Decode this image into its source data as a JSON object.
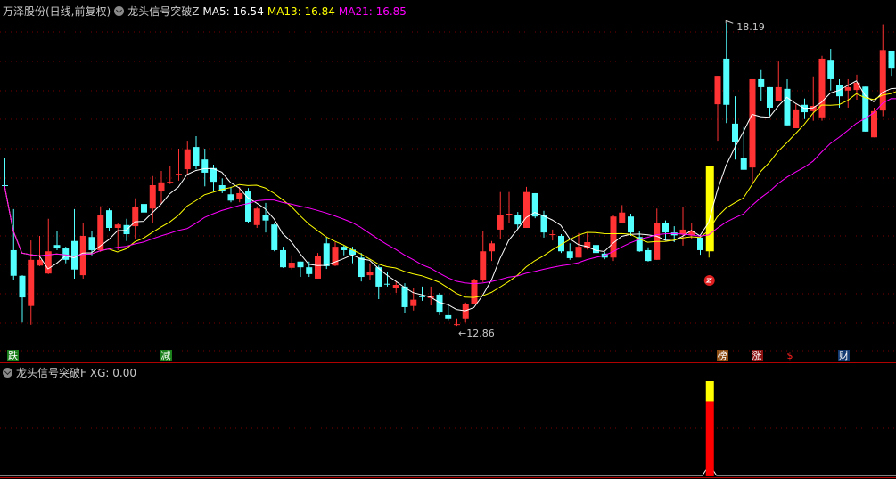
{
  "header": {
    "stock": "万泽股份(日线,前复权)",
    "indicator": "龙头信号突破Z",
    "ma5_label": "MA5: 16.54",
    "ma13_label": "MA13: 16.84",
    "ma21_label": "MA21: 16.85"
  },
  "sub_header": {
    "indicator": "龙头信号突破F",
    "xg_label": "XG: 0.00"
  },
  "markers": [
    {
      "text": "跌",
      "index": 0,
      "bg": "#1a7f1a",
      "fg": "#ffffff"
    },
    {
      "text": "减",
      "index": 18,
      "bg": "#1a7f1a",
      "fg": "#ffffff"
    },
    {
      "text": "榜",
      "index": 82,
      "bg": "#8b4a10",
      "fg": "#ffffff"
    },
    {
      "text": "涨",
      "index": 86,
      "bg": "#8b1010",
      "fg": "#ffffff"
    },
    {
      "text": "$",
      "index": 90,
      "bg": "transparent",
      "fg": "#ff2020"
    },
    {
      "text": "财",
      "index": 96,
      "bg": "#123a70",
      "fg": "#ffffff"
    }
  ],
  "colors": {
    "up": "#ff3333",
    "down": "#54ffff",
    "signal": "#ffff00",
    "ma5": "#ffffff",
    "ma13": "#ffff00",
    "ma21": "#ff00ff",
    "grid": "#7a0000"
  },
  "chart_data": {
    "type": "candlestick",
    "ylim": [
      12.88,
      18.19
    ],
    "high_label": "18.19",
    "low_label": "12.86",
    "high_index": 83,
    "low_index": 52,
    "signal_index": 81,
    "ohlc": [
      [
        15.35,
        15.82,
        15.29,
        15.34
      ],
      [
        14.21,
        14.93,
        13.68,
        13.76
      ],
      [
        13.76,
        13.77,
        12.94,
        13.38
      ],
      [
        13.23,
        14.38,
        12.9,
        14.04
      ],
      [
        13.94,
        14.46,
        13.93,
        14.04
      ],
      [
        13.8,
        14.76,
        13.79,
        14.19
      ],
      [
        14.3,
        14.54,
        14.21,
        14.24
      ],
      [
        14.24,
        14.27,
        13.98,
        14.04
      ],
      [
        14.37,
        14.93,
        13.71,
        13.87
      ],
      [
        13.77,
        14.68,
        13.71,
        14.46
      ],
      [
        14.44,
        14.54,
        14.12,
        14.21
      ],
      [
        14.21,
        14.98,
        14.18,
        14.83
      ],
      [
        14.91,
        14.94,
        14.54,
        14.6
      ],
      [
        14.6,
        14.69,
        14.21,
        14.66
      ],
      [
        14.65,
        14.76,
        14.37,
        14.49
      ],
      [
        14.63,
        15.12,
        14.4,
        14.96
      ],
      [
        15.02,
        15.38,
        14.79,
        14.87
      ],
      [
        14.94,
        15.51,
        14.68,
        15.35
      ],
      [
        15.24,
        15.6,
        15.02,
        15.4
      ],
      [
        15.4,
        15.68,
        15.37,
        15.41
      ],
      [
        15.54,
        15.99,
        15.43,
        15.55
      ],
      [
        15.63,
        16.13,
        15.52,
        15.98
      ],
      [
        16.02,
        16.21,
        15.63,
        15.69
      ],
      [
        15.8,
        15.99,
        15.33,
        15.57
      ],
      [
        15.65,
        15.71,
        15.24,
        15.41
      ],
      [
        15.35,
        15.47,
        15.21,
        15.24
      ],
      [
        15.19,
        15.32,
        15.05,
        15.08
      ],
      [
        15.1,
        15.32,
        15.05,
        15.21
      ],
      [
        15.24,
        15.3,
        14.68,
        14.71
      ],
      [
        14.65,
        14.96,
        14.6,
        14.94
      ],
      [
        14.82,
        15.04,
        14.52,
        14.73
      ],
      [
        14.66,
        14.69,
        14.19,
        14.21
      ],
      [
        14.21,
        14.27,
        13.9,
        13.91
      ],
      [
        13.9,
        14.12,
        13.87,
        13.99
      ],
      [
        14.01,
        14.01,
        13.74,
        13.91
      ],
      [
        13.91,
        14.01,
        13.74,
        13.79
      ],
      [
        13.71,
        14.16,
        13.71,
        14.1
      ],
      [
        14.33,
        14.43,
        13.88,
        13.93
      ],
      [
        13.94,
        14.35,
        13.93,
        14.27
      ],
      [
        14.27,
        14.29,
        14.12,
        14.21
      ],
      [
        14.22,
        14.27,
        13.98,
        14.13
      ],
      [
        14.08,
        14.16,
        13.66,
        13.74
      ],
      [
        13.77,
        13.98,
        13.69,
        13.82
      ],
      [
        13.91,
        13.94,
        13.35,
        13.57
      ],
      [
        13.62,
        13.83,
        13.57,
        13.6
      ],
      [
        13.54,
        13.66,
        13.46,
        13.6
      ],
      [
        13.57,
        13.63,
        13.1,
        13.21
      ],
      [
        13.23,
        13.55,
        13.15,
        13.34
      ],
      [
        13.4,
        13.57,
        13.32,
        13.38
      ],
      [
        13.37,
        13.57,
        13.24,
        13.41
      ],
      [
        13.43,
        13.46,
        13.07,
        13.13
      ],
      [
        13.07,
        13.26,
        12.98,
        13.01
      ],
      [
        12.9,
        13.01,
        12.88,
        12.91
      ],
      [
        13.01,
        13.29,
        12.94,
        13.27
      ],
      [
        13.27,
        13.71,
        13.26,
        13.69
      ],
      [
        13.69,
        14.54,
        13.65,
        14.19
      ],
      [
        14.19,
        14.37,
        14.02,
        14.33
      ],
      [
        14.57,
        15.23,
        14.41,
        14.83
      ],
      [
        14.85,
        15.23,
        14.69,
        14.85
      ],
      [
        14.82,
        14.88,
        14.58,
        14.66
      ],
      [
        14.6,
        15.32,
        14.6,
        15.23
      ],
      [
        15.21,
        15.21,
        14.77,
        14.8
      ],
      [
        14.82,
        14.9,
        14.43,
        14.52
      ],
      [
        14.49,
        14.57,
        14.38,
        14.49
      ],
      [
        14.46,
        14.49,
        14.16,
        14.19
      ],
      [
        14.19,
        14.33,
        14.04,
        14.07
      ],
      [
        14.08,
        14.51,
        14.08,
        14.27
      ],
      [
        14.24,
        14.51,
        14.22,
        14.35
      ],
      [
        14.3,
        14.37,
        14.02,
        14.16
      ],
      [
        14.15,
        14.18,
        14.05,
        14.08
      ],
      [
        14.08,
        14.82,
        14.02,
        14.8
      ],
      [
        14.68,
        15.0,
        14.68,
        14.87
      ],
      [
        14.8,
        14.85,
        14.46,
        14.52
      ],
      [
        14.44,
        14.54,
        14.18,
        14.19
      ],
      [
        14.21,
        14.26,
        14.01,
        14.02
      ],
      [
        14.04,
        14.94,
        14.04,
        14.68
      ],
      [
        14.68,
        14.73,
        14.38,
        14.52
      ],
      [
        14.52,
        14.63,
        14.35,
        14.47
      ],
      [
        14.49,
        14.96,
        14.29,
        14.57
      ],
      [
        14.47,
        14.69,
        14.41,
        14.54
      ],
      [
        14.43,
        14.46,
        14.13,
        14.21
      ],
      [
        14.19,
        15.68,
        14.08,
        15.68
      ],
      [
        16.77,
        17.27,
        16.13,
        17.27
      ],
      [
        17.57,
        18.19,
        16.44,
        16.76
      ],
      [
        16.43,
        16.91,
        15.8,
        16.1
      ],
      [
        15.82,
        16.37,
        15.62,
        15.62
      ],
      [
        15.66,
        17.21,
        15.37,
        17.21
      ],
      [
        17.21,
        17.37,
        16.82,
        17.07
      ],
      [
        17.07,
        17.07,
        16.57,
        16.71
      ],
      [
        16.82,
        17.52,
        16.82,
        17.07
      ],
      [
        17.04,
        17.21,
        16.4,
        16.4
      ],
      [
        16.35,
        16.77,
        16.35,
        16.68
      ],
      [
        16.76,
        16.87,
        16.51,
        16.63
      ],
      [
        16.65,
        17.26,
        16.48,
        16.74
      ],
      [
        16.54,
        17.62,
        16.48,
        17.57
      ],
      [
        17.55,
        17.74,
        17.01,
        17.21
      ],
      [
        17.1,
        17.21,
        16.71,
        16.91
      ],
      [
        17.01,
        17.21,
        16.71,
        17.07
      ],
      [
        17.02,
        17.29,
        16.85,
        17.15
      ],
      [
        17.08,
        17.08,
        16.29,
        16.29
      ],
      [
        16.19,
        16.71,
        16.19,
        16.65
      ],
      [
        16.66,
        18.17,
        16.56,
        17.72
      ],
      [
        17.71,
        17.71,
        17.27,
        17.41
      ],
      [
        17.5,
        17.6,
        17.1,
        17.2
      ]
    ],
    "xg": {
      "signal_index": 81,
      "value": 1,
      "yellow_fraction": 0.21
    }
  }
}
